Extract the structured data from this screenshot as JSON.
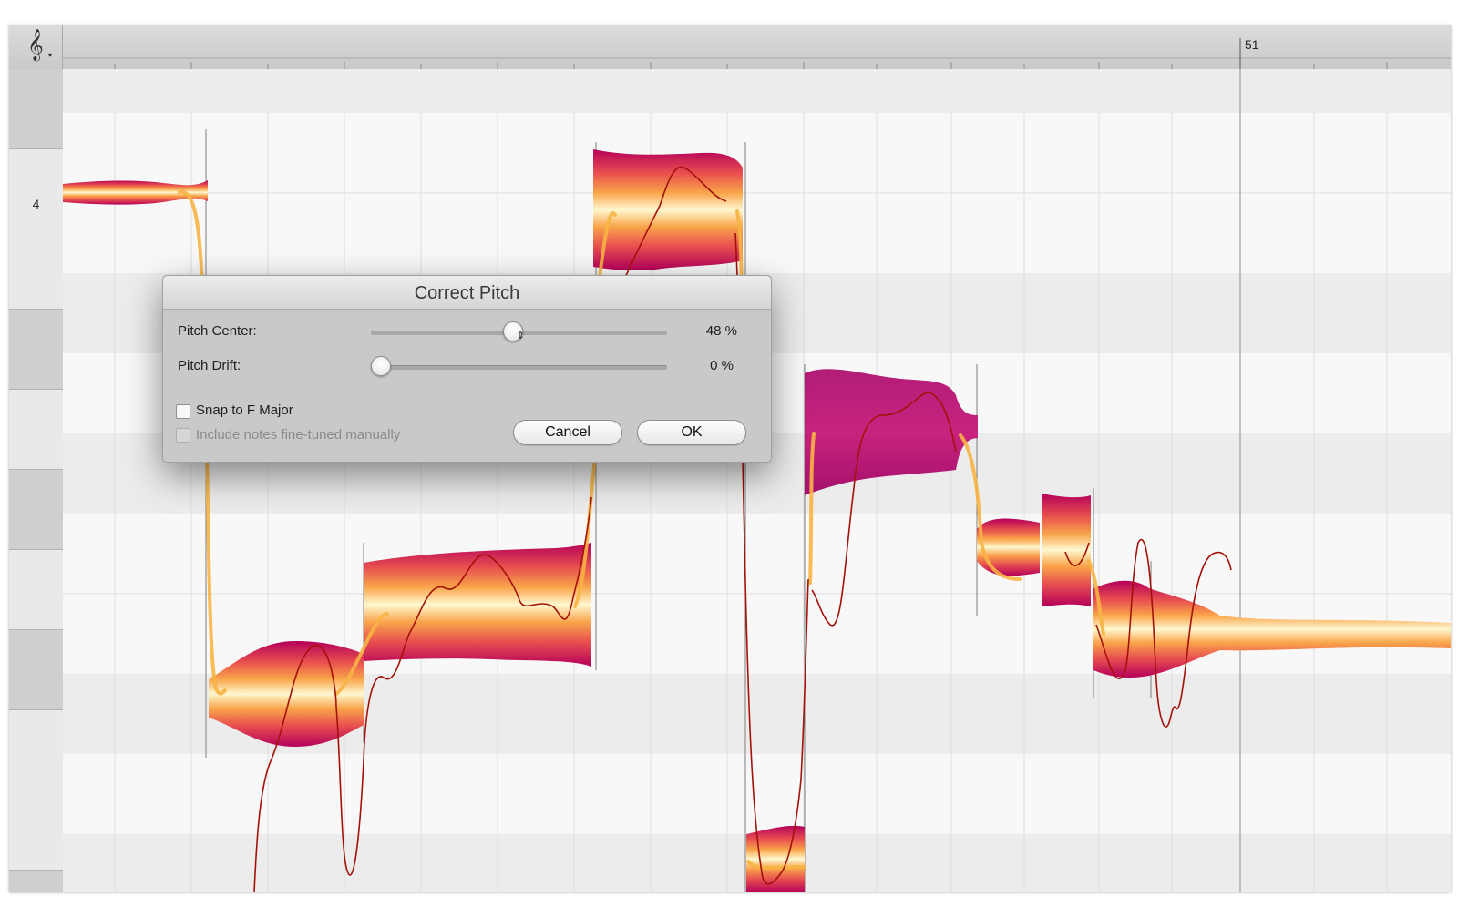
{
  "ruler": {
    "clef_icon": "treble-clef-icon",
    "clef_glyph": "𝄞",
    "caret_glyph": "▾",
    "bar_number": "51"
  },
  "keyboard": {
    "octave_label": "4"
  },
  "dialog": {
    "title": "Correct Pitch",
    "pitch_center": {
      "label": "Pitch Center:",
      "value": 48,
      "display": "48 %"
    },
    "pitch_drift": {
      "label": "Pitch Drift:",
      "value": 0,
      "display": "0 %"
    },
    "snap": {
      "label": "Snap to F Major",
      "checked": false
    },
    "include": {
      "label": "Include notes fine-tuned manually",
      "checked": false,
      "enabled": false
    },
    "cancel_label": "Cancel",
    "ok_label": "OK"
  },
  "colors": {
    "blob_edge": "#b5005a",
    "blob_mid": "#e8504f",
    "blob_warm": "#f9a54a",
    "blob_center": "#fff8d0",
    "pitch_curve": "#a3120a",
    "corrected_curve": "#f7b444"
  }
}
